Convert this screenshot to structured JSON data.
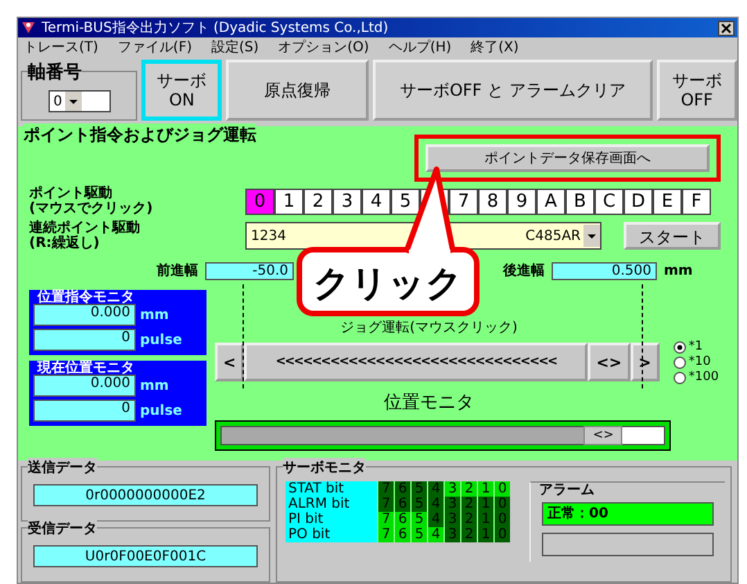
{
  "window": {
    "title": "Termi-BUS指令出力ソフト (Dyadic Systems Co.,Ltd)"
  },
  "menu": [
    "トレース(T)",
    "ファイル(F)",
    "設定(S)",
    "オプション(O)",
    "ヘルプ(H)",
    "終了(X)"
  ],
  "axis": {
    "label": "軸番号",
    "value": "0"
  },
  "toolbar": [
    {
      "lines": [
        "サーボ",
        "ON"
      ],
      "focused": true
    },
    {
      "lines": [
        "原点復帰"
      ],
      "focused": false
    },
    {
      "lines": [
        "サーボOFF と アラームクリア"
      ],
      "focused": false
    },
    {
      "lines": [
        "サーボ",
        "OFF"
      ],
      "focused": false
    }
  ],
  "panel": {
    "title": "ポイント指令およびジョグ運転",
    "save_button": {
      "label": "ポイントデータ保存画面へ",
      "highlighted": true
    },
    "callout": "クリック",
    "point_drive": {
      "lines": [
        "ポイント駆動",
        "(マウスでクリック)"
      ],
      "points": [
        {
          "label": "0",
          "selected": true
        },
        {
          "label": "1",
          "selected": false
        },
        {
          "label": "2",
          "selected": false
        },
        {
          "label": "3",
          "selected": false
        },
        {
          "label": "4",
          "selected": false
        },
        {
          "label": "5",
          "selected": false
        },
        {
          "selected": false
        },
        {
          "label": "7",
          "selected": false
        },
        {
          "label": "8",
          "selected": false
        },
        {
          "label": "9",
          "selected": false
        },
        {
          "label": "A",
          "selected": false
        },
        {
          "label": "B",
          "selected": false
        },
        {
          "label": "C",
          "selected": false
        },
        {
          "label": "D",
          "selected": false
        },
        {
          "label": "E",
          "selected": false
        },
        {
          "label": "F",
          "selected": false
        }
      ]
    },
    "continuous": {
      "lines": [
        "連続ポイント駆動",
        "(R:繰返し)"
      ],
      "value_start": "1234",
      "value_end": "C485AR",
      "start": "スタート"
    },
    "forward": {
      "label": "前進幅",
      "value": "-50.0"
    },
    "backward": {
      "label": "後進幅",
      "value": "0.500",
      "unit": "mm"
    },
    "monitors": [
      {
        "title": "位置指令モニタ",
        "mm": "0.000",
        "mm_unit": "mm",
        "pulse": "0",
        "pulse_unit": "pulse"
      },
      {
        "title": "現在位置モニタ",
        "mm": "0.000",
        "mm_unit": "mm",
        "pulse": "0",
        "pulse_unit": "pulse"
      }
    ],
    "jog": {
      "label": "ジョグ運転(マウスクリック)",
      "left": "<",
      "track": "<<<<<<<<<<<<<<<<<<<<<<<<<<<<<<<",
      "center": "<>",
      "right": ">"
    },
    "scale": [
      {
        "label": "*1",
        "selected": true
      },
      {
        "label": "*10",
        "selected": false
      },
      {
        "label": "*100",
        "selected": false
      }
    ],
    "position": {
      "label": "位置モニタ",
      "level": 0.86,
      "thumb": "<>"
    }
  },
  "send": {
    "title": "送信データ",
    "value": "0r0000000000E2"
  },
  "receive": {
    "title": "受信データ",
    "value": "U0r0F00E0F001C"
  },
  "servo_monitor": {
    "title": "サーボモニタ",
    "rows": [
      {
        "label": "STAT bit",
        "bits": [
          {
            "label": "7",
            "on": false
          },
          {
            "label": "6",
            "on": false
          },
          {
            "label": "5",
            "on": false
          },
          {
            "label": "4",
            "on": false
          },
          {
            "label": "3",
            "on": true
          },
          {
            "label": "2",
            "on": true
          },
          {
            "label": "1",
            "on": true
          },
          {
            "label": "0",
            "on": true
          }
        ]
      },
      {
        "label": "ALRM bit",
        "bits": [
          {
            "label": "7",
            "on": false
          },
          {
            "label": "6",
            "on": false
          },
          {
            "label": "5",
            "on": false
          },
          {
            "label": "4",
            "on": false
          },
          {
            "label": "3",
            "on": false
          },
          {
            "label": "2",
            "on": false
          },
          {
            "label": "1",
            "on": false
          },
          {
            "label": "0",
            "on": false
          }
        ]
      },
      {
        "label": "PI bit",
        "bits": [
          {
            "label": "7",
            "on": true
          },
          {
            "label": "6",
            "on": true
          },
          {
            "label": "5",
            "on": true
          },
          {
            "label": "4",
            "on": false
          },
          {
            "label": "3",
            "on": false
          },
          {
            "label": "2",
            "on": false
          },
          {
            "label": "1",
            "on": false
          },
          {
            "label": "0",
            "on": false
          }
        ]
      },
      {
        "label": "PO bit",
        "bits": [
          {
            "label": "7",
            "on": true
          },
          {
            "label": "6",
            "on": true
          },
          {
            "label": "5",
            "on": true
          },
          {
            "label": "4",
            "on": true
          },
          {
            "label": "3",
            "on": false
          },
          {
            "label": "2",
            "on": false
          },
          {
            "label": "1",
            "on": false
          },
          {
            "label": "0",
            "on": false
          }
        ]
      }
    ]
  },
  "alarm": {
    "title": "アラーム",
    "status": "正常：00"
  }
}
